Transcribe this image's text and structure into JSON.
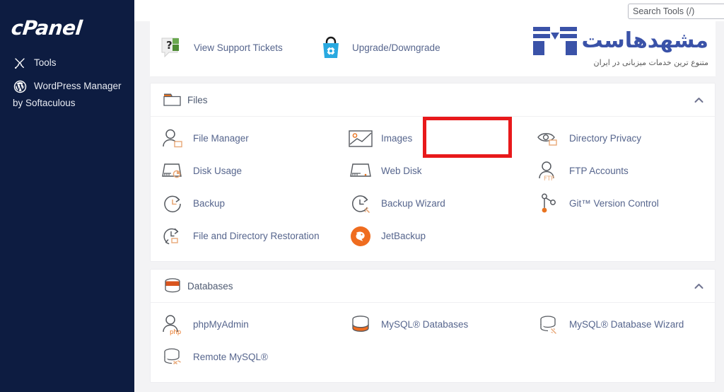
{
  "sidebar": {
    "brand": "cPanel",
    "items": [
      {
        "label": "Tools",
        "icon": "tools-icon"
      },
      {
        "label": "WordPress Manager",
        "sublabel": "by Softaculous",
        "icon": "wordpress-icon"
      }
    ]
  },
  "search": {
    "placeholder": "Search Tools (/)",
    "value": ""
  },
  "quicklinks": [
    {
      "label": "View Support Tickets",
      "icon": "support-ticket-icon"
    },
    {
      "label": "Upgrade/Downgrade",
      "icon": "shopping-bag-gear-icon"
    }
  ],
  "hoster": {
    "name": "مشهدهاست",
    "tagline": "متنوع ترین خدمات میزبانی در ایران"
  },
  "sections": [
    {
      "title": "Files",
      "icon": "folder-icon",
      "collapse_icon": "chevron-up-icon",
      "items": [
        {
          "label": "File Manager",
          "icon": "file-manager-icon",
          "highlighted": false
        },
        {
          "label": "Images",
          "icon": "images-icon",
          "highlighted": true
        },
        {
          "label": "Directory Privacy",
          "icon": "directory-privacy-icon",
          "highlighted": false
        },
        {
          "label": "Disk Usage",
          "icon": "disk-usage-icon",
          "highlighted": false
        },
        {
          "label": "Web Disk",
          "icon": "web-disk-icon",
          "highlighted": false
        },
        {
          "label": "FTP Accounts",
          "icon": "ftp-accounts-icon",
          "highlighted": false
        },
        {
          "label": "Backup",
          "icon": "backup-icon",
          "highlighted": false
        },
        {
          "label": "Backup Wizard",
          "icon": "backup-wizard-icon",
          "highlighted": false
        },
        {
          "label": "Git™ Version Control",
          "icon": "git-icon",
          "highlighted": false
        },
        {
          "label": "File and Directory Restoration",
          "icon": "file-restore-icon",
          "highlighted": false
        },
        {
          "label": "JetBackup",
          "icon": "jetbackup-icon",
          "highlighted": false
        }
      ]
    },
    {
      "title": "Databases",
      "icon": "database-icon",
      "collapse_icon": "chevron-up-icon",
      "items": [
        {
          "label": "phpMyAdmin",
          "icon": "phpmyadmin-icon"
        },
        {
          "label": "MySQL® Databases",
          "icon": "mysql-databases-icon"
        },
        {
          "label": "MySQL® Database Wizard",
          "icon": "mysql-wizard-icon"
        },
        {
          "label": "Remote MySQL®",
          "icon": "remote-mysql-icon"
        }
      ]
    }
  ],
  "colors": {
    "sidebar_bg": "#0d1c41",
    "link_text": "#56658d",
    "accent_orange": "#e8731f",
    "highlight_red": "#e8191b",
    "logo_blue": "#3a52a8"
  }
}
